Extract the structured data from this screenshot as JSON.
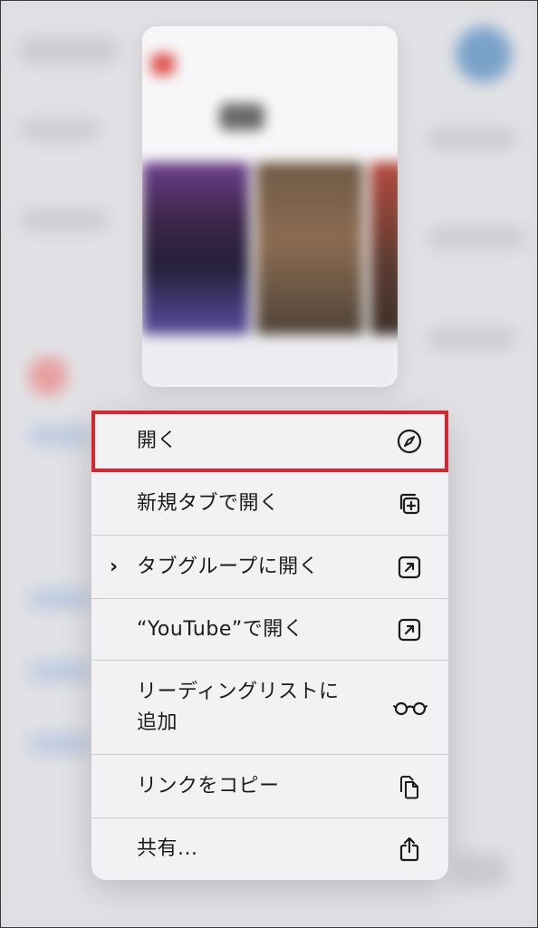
{
  "menu": {
    "items": [
      {
        "label": "開く",
        "icon": "compass-icon",
        "chevron": false
      },
      {
        "label": "新規タブで開く",
        "icon": "new-tab-plus-icon",
        "chevron": false
      },
      {
        "label": "タブグループに開く",
        "icon": "open-external-arrow-icon",
        "chevron": true,
        "chevron_glyph": "›"
      },
      {
        "label": "“YouTube”で開く",
        "icon": "open-external-arrow-icon",
        "chevron": false
      },
      {
        "label": "リーディングリストに追加",
        "icon": "reading-glasses-icon",
        "chevron": false
      },
      {
        "label": "リンクをコピー",
        "icon": "copy-documents-icon",
        "chevron": false
      },
      {
        "label": "共有...",
        "icon": "share-icon",
        "chevron": false
      }
    ]
  },
  "colors": {
    "highlight_border": "#d9262f",
    "menu_background": "#f2f2f4",
    "text": "#1c1c1e"
  }
}
